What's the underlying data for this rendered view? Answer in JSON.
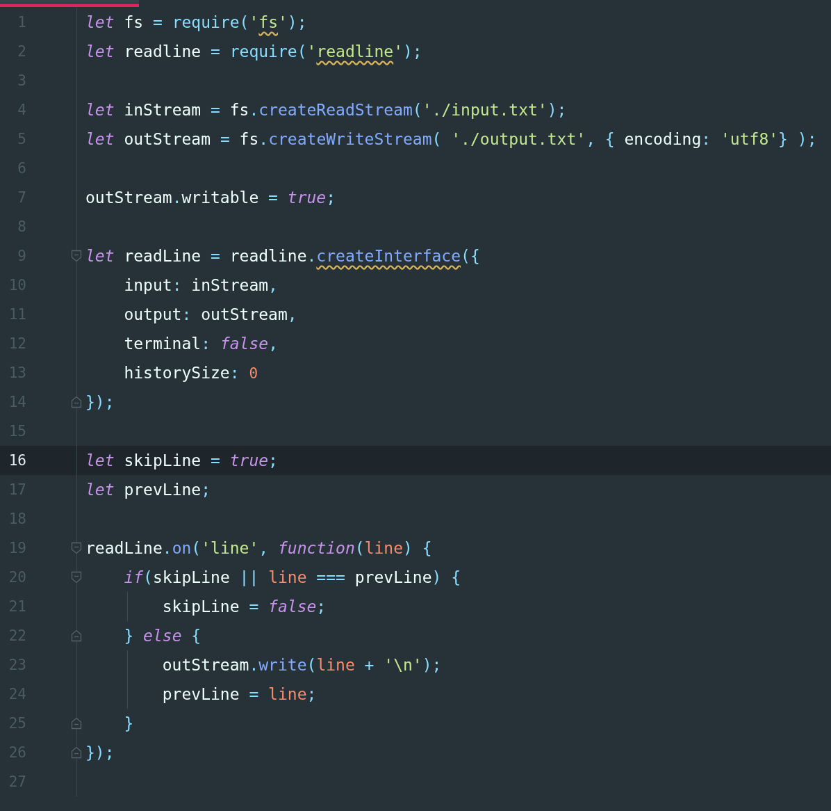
{
  "lines": [
    {
      "number": "1",
      "selected": false,
      "tokens": [
        {
          "text": "let",
          "kind": "kw"
        },
        {
          "text": " fs",
          "kind": "id"
        },
        {
          "text": " = ",
          "kind": "op"
        },
        {
          "text": "require",
          "kind": "fn"
        },
        {
          "text": "(",
          "kind": "op"
        },
        {
          "text": "'",
          "kind": "str"
        },
        {
          "text": "fs",
          "kind": "str",
          "warning": true
        },
        {
          "text": "'",
          "kind": "str"
        },
        {
          "text": ");",
          "kind": "op"
        }
      ]
    },
    {
      "number": "2",
      "selected": false,
      "tokens": [
        {
          "text": "let",
          "kind": "kw"
        },
        {
          "text": " readline",
          "kind": "id"
        },
        {
          "text": " = ",
          "kind": "op"
        },
        {
          "text": "require",
          "kind": "fn"
        },
        {
          "text": "(",
          "kind": "op"
        },
        {
          "text": "'",
          "kind": "str"
        },
        {
          "text": "readline",
          "kind": "str",
          "warning": true
        },
        {
          "text": "'",
          "kind": "str"
        },
        {
          "text": ");",
          "kind": "op"
        }
      ]
    },
    {
      "number": "3",
      "selected": false
    },
    {
      "number": "4",
      "selected": false,
      "tokens": [
        {
          "text": "let",
          "kind": "kw"
        },
        {
          "text": " inStream",
          "kind": "id"
        },
        {
          "text": " = ",
          "kind": "op"
        },
        {
          "text": "fs",
          "kind": "id"
        },
        {
          "text": ".",
          "kind": "op"
        },
        {
          "text": "createReadStream",
          "kind": "method"
        },
        {
          "text": "(",
          "kind": "op"
        },
        {
          "text": "'./input.txt'",
          "kind": "str"
        },
        {
          "text": ");",
          "kind": "op"
        }
      ]
    },
    {
      "number": "5",
      "selected": false,
      "tokens": [
        {
          "text": "let",
          "kind": "kw"
        },
        {
          "text": " outStream",
          "kind": "id"
        },
        {
          "text": " = ",
          "kind": "op"
        },
        {
          "text": "fs",
          "kind": "id"
        },
        {
          "text": ".",
          "kind": "op"
        },
        {
          "text": "createWriteStream",
          "kind": "method"
        },
        {
          "text": "( ",
          "kind": "op"
        },
        {
          "text": "'./output.txt'",
          "kind": "str"
        },
        {
          "text": ", { ",
          "kind": "op"
        },
        {
          "text": "encoding",
          "kind": "id"
        },
        {
          "text": ": ",
          "kind": "op"
        },
        {
          "text": "'utf8'",
          "kind": "str"
        },
        {
          "text": "} );",
          "kind": "op"
        }
      ]
    },
    {
      "number": "6",
      "selected": false
    },
    {
      "number": "7",
      "selected": false,
      "tokens": [
        {
          "text": "outStream",
          "kind": "id"
        },
        {
          "text": ".",
          "kind": "op"
        },
        {
          "text": "writable",
          "kind": "id"
        },
        {
          "text": " = ",
          "kind": "op"
        },
        {
          "text": "true",
          "kind": "bool"
        },
        {
          "text": ";",
          "kind": "op"
        }
      ]
    },
    {
      "number": "8",
      "selected": false
    },
    {
      "number": "9",
      "selected": false,
      "fold": {
        "kind": "start"
      },
      "tokens": [
        {
          "text": "let",
          "kind": "kw"
        },
        {
          "text": " readLine",
          "kind": "id"
        },
        {
          "text": " = ",
          "kind": "op"
        },
        {
          "text": "readline",
          "kind": "id"
        },
        {
          "text": ".",
          "kind": "op"
        },
        {
          "text": "createInterface",
          "kind": "method",
          "warning": true
        },
        {
          "text": "({",
          "kind": "op"
        }
      ]
    },
    {
      "number": "10",
      "selected": false,
      "tokens": [
        {
          "text": "    input",
          "kind": "id"
        },
        {
          "text": ": ",
          "kind": "op"
        },
        {
          "text": "inStream",
          "kind": "id"
        },
        {
          "text": ",",
          "kind": "op"
        }
      ]
    },
    {
      "number": "11",
      "selected": false,
      "tokens": [
        {
          "text": "    output",
          "kind": "id"
        },
        {
          "text": ": ",
          "kind": "op"
        },
        {
          "text": "outStream",
          "kind": "id"
        },
        {
          "text": ",",
          "kind": "op"
        }
      ]
    },
    {
      "number": "12",
      "selected": false,
      "tokens": [
        {
          "text": "    terminal",
          "kind": "id"
        },
        {
          "text": ": ",
          "kind": "op"
        },
        {
          "text": "false",
          "kind": "bool"
        },
        {
          "text": ",",
          "kind": "op"
        }
      ]
    },
    {
      "number": "13",
      "selected": false,
      "tokens": [
        {
          "text": "    historySize",
          "kind": "id"
        },
        {
          "text": ": ",
          "kind": "op"
        },
        {
          "text": "0",
          "kind": "num"
        }
      ]
    },
    {
      "number": "14",
      "selected": false,
      "fold": {
        "kind": "end"
      },
      "tokens": [
        {
          "text": "});",
          "kind": "op"
        }
      ]
    },
    {
      "number": "15",
      "selected": false
    },
    {
      "number": "16",
      "selected": true,
      "tokens": [
        {
          "text": "let",
          "kind": "kw"
        },
        {
          "text": " skipLine",
          "kind": "id"
        },
        {
          "text": " = ",
          "kind": "op"
        },
        {
          "text": "true",
          "kind": "bool"
        },
        {
          "text": ";",
          "kind": "op"
        }
      ]
    },
    {
      "number": "17",
      "selected": false,
      "tokens": [
        {
          "text": "let",
          "kind": "kw"
        },
        {
          "text": " prevLine",
          "kind": "id"
        },
        {
          "text": ";",
          "kind": "op"
        }
      ]
    },
    {
      "number": "18",
      "selected": false
    },
    {
      "number": "19",
      "selected": false,
      "fold": {
        "kind": "start"
      },
      "tokens": [
        {
          "text": "readLine",
          "kind": "id"
        },
        {
          "text": ".",
          "kind": "op"
        },
        {
          "text": "on",
          "kind": "method"
        },
        {
          "text": "(",
          "kind": "op"
        },
        {
          "text": "'line'",
          "kind": "str"
        },
        {
          "text": ", ",
          "kind": "op"
        },
        {
          "text": "function",
          "kind": "kw"
        },
        {
          "text": "(",
          "kind": "op"
        },
        {
          "text": "line",
          "kind": "param"
        },
        {
          "text": ") {",
          "kind": "op"
        }
      ]
    },
    {
      "number": "20",
      "selected": false,
      "fold": {
        "kind": "start"
      },
      "tokens": [
        {
          "text": "    if",
          "kind": "kw"
        },
        {
          "text": "(",
          "kind": "op"
        },
        {
          "text": "skipLine ",
          "kind": "id"
        },
        {
          "text": "|| ",
          "kind": "op"
        },
        {
          "text": "line",
          "kind": "param"
        },
        {
          "text": " === ",
          "kind": "op"
        },
        {
          "text": "prevLine",
          "kind": "id"
        },
        {
          "text": ") {",
          "kind": "op"
        }
      ]
    },
    {
      "number": "21",
      "selected": false,
      "tokens": [
        {
          "text": "        skipLine",
          "kind": "id"
        },
        {
          "text": " = ",
          "kind": "op"
        },
        {
          "text": "false",
          "kind": "bool"
        },
        {
          "text": ";",
          "kind": "op"
        }
      ]
    },
    {
      "number": "22",
      "selected": false,
      "fold": {
        "kind": "end"
      },
      "tokens": [
        {
          "text": "    } ",
          "kind": "op"
        },
        {
          "text": "else",
          "kind": "kw"
        },
        {
          "text": " {",
          "kind": "op"
        }
      ]
    },
    {
      "number": "23",
      "selected": false,
      "tokens": [
        {
          "text": "        outStream",
          "kind": "id"
        },
        {
          "text": ".",
          "kind": "op"
        },
        {
          "text": "write",
          "kind": "method"
        },
        {
          "text": "(",
          "kind": "op"
        },
        {
          "text": "line",
          "kind": "param"
        },
        {
          "text": " + ",
          "kind": "op"
        },
        {
          "text": "'\\n'",
          "kind": "str"
        },
        {
          "text": ");",
          "kind": "op"
        }
      ]
    },
    {
      "number": "24",
      "selected": false,
      "tokens": [
        {
          "text": "        prevLine",
          "kind": "id"
        },
        {
          "text": " = ",
          "kind": "op"
        },
        {
          "text": "line",
          "kind": "param"
        },
        {
          "text": ";",
          "kind": "op"
        }
      ]
    },
    {
      "number": "25",
      "selected": false,
      "fold": {
        "kind": "end"
      },
      "tokens": [
        {
          "text": "    }",
          "kind": "op"
        }
      ]
    },
    {
      "number": "26",
      "selected": false,
      "fold": {
        "kind": "end"
      },
      "tokens": [
        {
          "text": "});",
          "kind": "op"
        }
      ]
    },
    {
      "number": "27",
      "selected": false
    }
  ]
}
